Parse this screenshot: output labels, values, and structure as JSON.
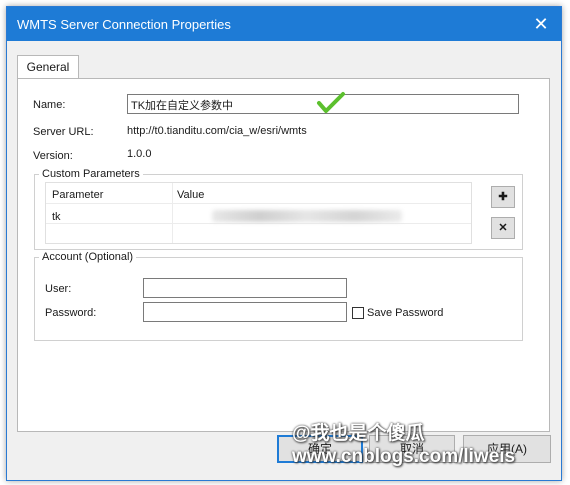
{
  "window": {
    "title": "WMTS Server Connection Properties",
    "close_glyph": "✕"
  },
  "tabs": [
    {
      "label": "General"
    }
  ],
  "form": {
    "name_label": "Name:",
    "name_value": "TK加在自定义参数中",
    "server_url_label": "Server URL:",
    "server_url_value": "http://t0.tianditu.com/cia_w/esri/wmts",
    "version_label": "Version:",
    "version_value": "1.0.0"
  },
  "custom_parameters": {
    "legend": "Custom Parameters",
    "columns": [
      "Parameter",
      "Value"
    ],
    "rows": [
      {
        "parameter": "tk",
        "value": ""
      }
    ],
    "add_glyph": "✚",
    "remove_glyph": "✕"
  },
  "account": {
    "legend": "Account (Optional)",
    "user_label": "User:",
    "user_value": "",
    "password_label": "Password:",
    "password_value": "",
    "save_password_label": "Save Password",
    "save_password_checked": false
  },
  "buttons": {
    "ok": "确定",
    "cancel": "取消",
    "apply": "应用(A)"
  },
  "annotation": {
    "checkmark_color": "#5cc02e"
  },
  "watermark": {
    "line1": "@我也是个傻瓜",
    "line2": "www.cnblogs.com/liweis"
  },
  "colors": {
    "titlebar": "#1e7bd6",
    "default_button_border": "#1e7bd6"
  }
}
